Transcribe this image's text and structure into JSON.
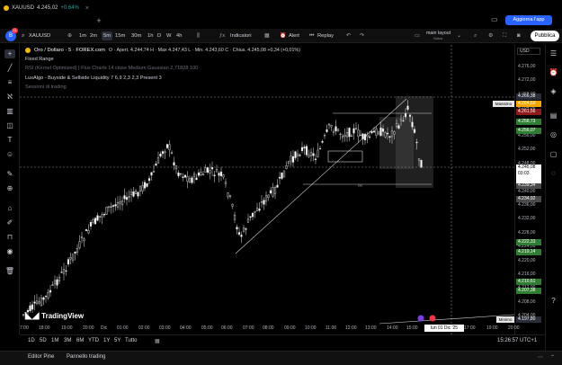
{
  "tab": {
    "symbol": "XAUUSD",
    "price": "4.245,02",
    "change": "+0.64%"
  },
  "topbar": {
    "upgrade_label": "Aggiorna l'app"
  },
  "toolbar": {
    "avatar_letter": "B",
    "notif_count": "11",
    "symbol": "XAUUSD",
    "intervals": [
      "1m",
      "2m",
      "5m",
      "15m",
      "30m",
      "1h",
      "D",
      "W",
      "4h"
    ],
    "selected_interval": "5m",
    "indicators_label": "Indicatori",
    "alert_label": "Alert",
    "replay_label": "Replay",
    "layout_label": "main layout",
    "layout_sub": "Salva",
    "publish_label": "Pubblica"
  },
  "legend": {
    "title": "Oro / Dollaro · 5 · FOREX.com",
    "ohlc": "O · Apert. 4.244,74  H · Max 4.247,43  L · Min. 4.243,60  C · Chius. 4.245,08  +0,34 (+0,01%)",
    "fixed_range": "Fixed Range",
    "indicator1": "RSI (Kernel Optimized) | Flux Charts 14 close Medium Gaussian 2,71828 100",
    "indicator2": "LuxAlgo - Buyside & Sellside Liquidity  7 6,9 2,3 2,3 Present 3",
    "indicator3": "Sessioni di trading"
  },
  "price_scale": {
    "currency": "USD",
    "labels": [
      "4.276,00",
      "4.272,00",
      "4.268,00",
      "4.264,00",
      "4.260,00",
      "4.256,00",
      "4.252,00",
      "4.248,00",
      "4.244,00",
      "4.240,00",
      "4.236,00",
      "4.232,00",
      "4.228,00",
      "4.224,00",
      "4.220,00",
      "4.216,00",
      "4.212,00",
      "4.208,00",
      "4.204,00"
    ],
    "boxes": [
      {
        "text": "4.266,38",
        "color": "#2a2e39"
      },
      {
        "text": "4.264,60",
        "color": "#f7a600"
      },
      {
        "text": "4.261,56",
        "color": "#8b1a1a"
      },
      {
        "text": "4.258,73",
        "color": "#2e7d32"
      },
      {
        "text": "4.256,07",
        "color": "#2e7d32"
      },
      {
        "text": "4.244,41",
        "color": "#2a2e39"
      },
      {
        "text": "4.239,34",
        "color": "#4a4a4a"
      },
      {
        "text": "4.234,92",
        "color": "#4a4a4a"
      },
      {
        "text": "4.222,33",
        "color": "#2e7d32"
      },
      {
        "text": "4.219,14",
        "color": "#2e7d32"
      },
      {
        "text": "4.210,61",
        "color": "#2e7d32"
      },
      {
        "text": "4.207,38",
        "color": "#2e7d32"
      },
      {
        "text": "4.197,80",
        "color": "#2a2e39"
      }
    ],
    "current": {
      "price": "4.245,08",
      "countdown": "03:03"
    },
    "max_label": "Massimo",
    "min_label": "Minimo"
  },
  "time_axis": {
    "labels": [
      "7:00",
      "18:00",
      "19:00",
      "20:00",
      "Dic",
      "01:00",
      "02:00",
      "03:00",
      "04:00",
      "05:00",
      "06:00",
      "07:00",
      "08:00",
      "09:00",
      "10:00",
      "11:00",
      "12:00",
      "13:00",
      "14:00",
      "15:00",
      "17:00",
      "19:00",
      "20:00"
    ],
    "crosshair": "lun 01 Dic '25  17:00"
  },
  "bottom": {
    "ranges": [
      "1D",
      "5D",
      "1M",
      "3M",
      "6M",
      "YTD",
      "1Y",
      "5Y",
      "Tutto"
    ],
    "clock": "15:26:57 UTC+1"
  },
  "panels": {
    "editor": "Editor Pine",
    "trading": "Pannello trading"
  },
  "branding": "TradingView"
}
